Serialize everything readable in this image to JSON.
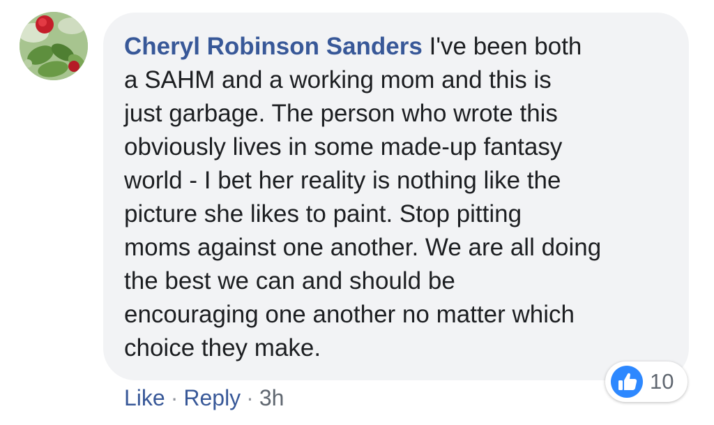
{
  "comment": {
    "author": "Cheryl Robinson Sanders",
    "first_line_rest": " I've been both",
    "lines": [
      "a SAHM and a working mom and this is",
      "just garbage. The person who wrote this",
      "obviously lives in some made-up fantasy",
      "world - I bet her reality is nothing like the",
      "picture she likes to paint. Stop pitting",
      "moms against one another. We are all doing",
      "the best we can and should be",
      "encouraging one another no matter which",
      "choice they make."
    ],
    "reactions": {
      "icon": "thumbs-up-icon",
      "count": "10",
      "color": "#2d88ff"
    }
  },
  "actions": {
    "like_label": "Like",
    "separator": "·",
    "reply_label": "Reply",
    "timestamp": "3h"
  },
  "colors": {
    "author": "#385898",
    "bubble": "#f2f3f5",
    "text": "#1c1e21",
    "meta": "#606770"
  }
}
